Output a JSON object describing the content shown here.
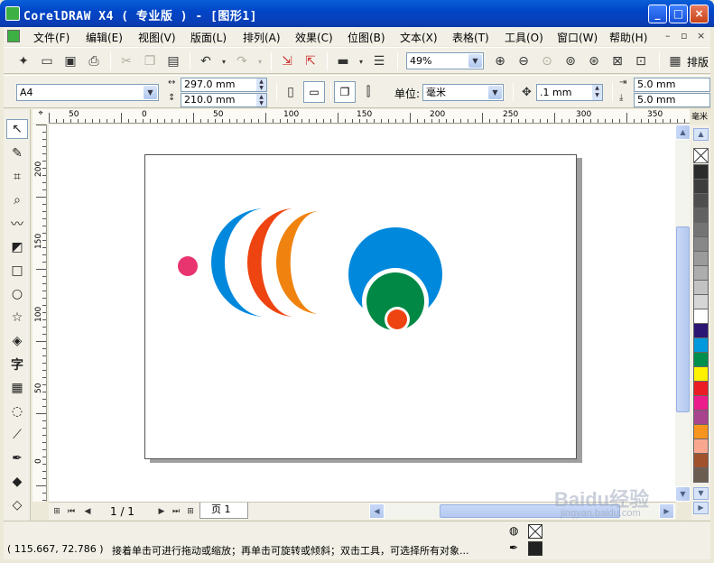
{
  "window": {
    "title": "CorelDRAW X4 ( 专业版 ) - [图形1]",
    "min_label": "_",
    "max_label": "□",
    "close_label": "×"
  },
  "menu": {
    "items": [
      "文件(F)",
      "编辑(E)",
      "视图(V)",
      "版面(L)",
      "排列(A)",
      "效果(C)",
      "位图(B)",
      "文本(X)",
      "表格(T)",
      "工具(O)",
      "窗口(W)",
      "帮助(H)"
    ],
    "controls": [
      "–",
      "▫",
      "×"
    ]
  },
  "std_toolbar": {
    "zoom": "49%",
    "layout_label": "排版"
  },
  "property_bar": {
    "paper_size": "A4",
    "width": "297.0 mm",
    "height": "210.0 mm",
    "units_label": "单位:",
    "units_value": "毫米",
    "nudge": ".1 mm",
    "dup_x": "5.0 mm",
    "dup_y": "5.0 mm"
  },
  "rulers": {
    "h_labels": [
      "50",
      "0",
      "50",
      "100",
      "150",
      "200",
      "250",
      "300",
      "350"
    ],
    "v_labels": [
      "200",
      "150",
      "100",
      "50",
      "0"
    ],
    "unit": "毫米"
  },
  "page_nav": {
    "count": "1 / 1",
    "tab": "页 1"
  },
  "status": {
    "coords": "( 115.667, 72.786 )",
    "hint": "接着单击可进行拖动或缩放；再单击可旋转或倾斜；双击工具，可选择所有对象..."
  },
  "watermark": {
    "main": "Baidu经验",
    "sub": "jingyan.baidu.com"
  },
  "palette": {
    "colors": [
      "#2b2b2b",
      "#3d3d3d",
      "#4e4e4e",
      "#626262",
      "#747474",
      "#888888",
      "#9b9b9b",
      "#adadad",
      "#c2c2c2",
      "#d6d6d6",
      "#ffffff",
      "#2c1673",
      "#0099dd",
      "#008f4c",
      "#fff200",
      "#ec1c24",
      "#ec1c8c",
      "#a8448e",
      "#f7941d",
      "#f9a88f",
      "#a0522d",
      "#6b5d4f"
    ]
  },
  "artwork": {
    "colors": {
      "blue": "#0088dd",
      "orange_red": "#ee4411",
      "orange": "#f0830f",
      "pink": "#e8346f",
      "green": "#008844",
      "red_orange": "#ee4411"
    }
  }
}
